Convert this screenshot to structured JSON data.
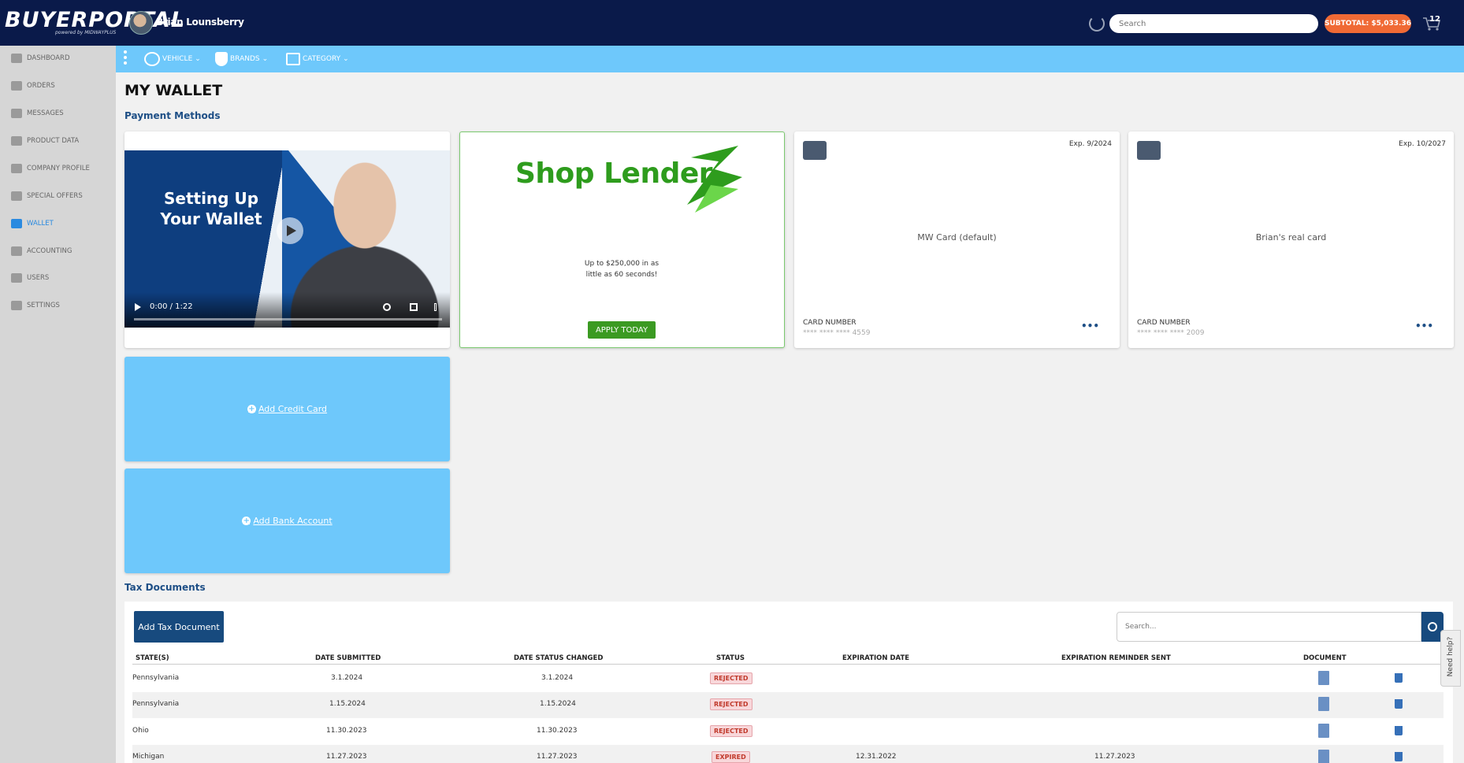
{
  "header": {
    "logo": "BUYERPORTAL",
    "logo_sub": "powered by MIDWAYPLUS",
    "user_name": "Brian Lounsberry",
    "search_placeholder": "Search",
    "subtotal": "SUBTOTAL: $5,033.36",
    "cart_count": "12"
  },
  "sidebar": {
    "items": [
      {
        "label": "DASHBOARD",
        "icon": "dashboard-icon"
      },
      {
        "label": "ORDERS",
        "icon": "orders-icon"
      },
      {
        "label": "MESSAGES",
        "icon": "messages-icon"
      },
      {
        "label": "PRODUCT DATA",
        "icon": "product-data-icon"
      },
      {
        "label": "COMPANY PROFILE",
        "icon": "company-profile-icon"
      },
      {
        "label": "SPECIAL OFFERS",
        "icon": "special-offers-icon"
      },
      {
        "label": "WALLET",
        "icon": "wallet-icon",
        "active": true
      },
      {
        "label": "ACCOUNTING",
        "icon": "accounting-icon"
      },
      {
        "label": "USERS",
        "icon": "users-icon"
      },
      {
        "label": "SETTINGS",
        "icon": "settings-icon"
      }
    ]
  },
  "subnav": {
    "vehicle": "VEHICLE",
    "brands": "BRANDS",
    "category": "CATEGORY"
  },
  "page": {
    "title": "MY WALLET",
    "payment_methods_title": "Payment Methods",
    "tax_documents_title": "Tax Documents"
  },
  "video": {
    "title_line1": "Setting Up",
    "title_line2": "Your Wallet",
    "time": "0:00 / 1:22"
  },
  "lender": {
    "name": "Shop Lender",
    "text_line1": "Up to $250,000 in as",
    "text_line2": "little as 60 seconds!",
    "apply_label": "APPLY TODAY",
    "accent_color": "#2e9c1d"
  },
  "cards": [
    {
      "exp": "Exp. 9/2024",
      "name": "MW Card (default)",
      "number_label": "CARD NUMBER",
      "number": "**** **** **** 4559"
    },
    {
      "exp": "Exp. 10/2027",
      "name": "Brian's real card",
      "number_label": "CARD NUMBER",
      "number": "**** **** **** 2009"
    }
  ],
  "add_actions": {
    "credit_card": "Add Credit Card",
    "bank_account": "Add Bank Account"
  },
  "tax": {
    "add_button": "Add Tax Document",
    "search_placeholder": "Search...",
    "columns": [
      "STATE(S)",
      "DATE SUBMITTED",
      "DATE STATUS CHANGED",
      "STATUS",
      "EXPIRATION DATE",
      "EXPIRATION REMINDER SENT",
      "DOCUMENT"
    ],
    "rows": [
      {
        "state": "Pennsylvania",
        "submitted": "3.1.2024",
        "changed": "3.1.2024",
        "status": "REJECTED",
        "expiration": "",
        "reminder": ""
      },
      {
        "state": "Pennsylvania",
        "submitted": "1.15.2024",
        "changed": "1.15.2024",
        "status": "REJECTED",
        "expiration": "",
        "reminder": ""
      },
      {
        "state": "Ohio",
        "submitted": "11.30.2023",
        "changed": "11.30.2023",
        "status": "REJECTED",
        "expiration": "",
        "reminder": ""
      },
      {
        "state": "Michigan",
        "submitted": "11.27.2023",
        "changed": "11.27.2023",
        "status": "EXPIRED",
        "expiration": "12.31.2022",
        "reminder": "11.27.2023"
      }
    ]
  },
  "help": {
    "label": "Need help?"
  },
  "colors": {
    "header_bg": "#0a1a4a",
    "subnav_bg": "#6ec8fb",
    "primary": "#174a7e",
    "subtotal": "#f06a35"
  }
}
